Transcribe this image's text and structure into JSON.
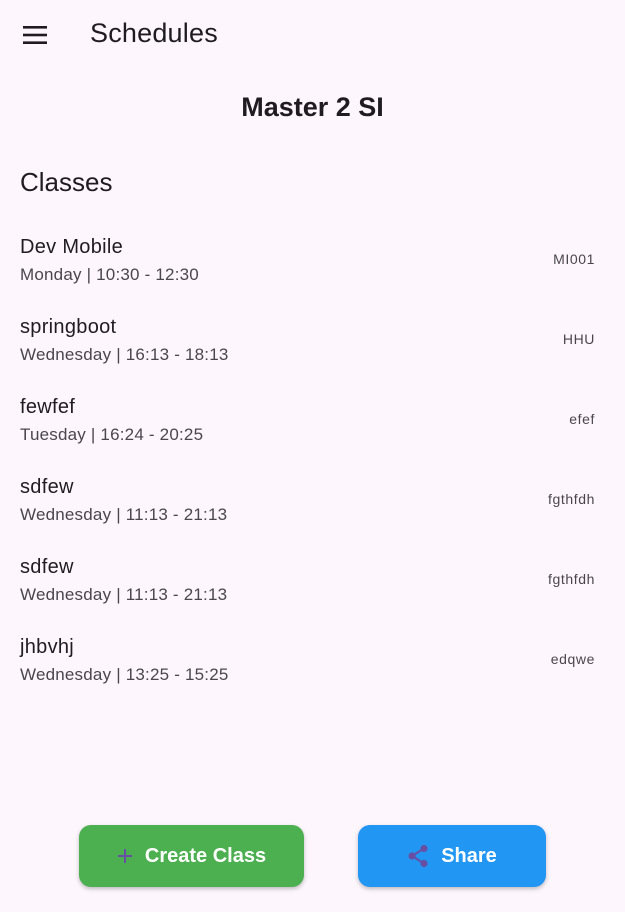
{
  "appbar": {
    "menu_icon": "menu-icon",
    "title": "Schedules"
  },
  "schedule": {
    "name": "Master 2 SI"
  },
  "classes_section": {
    "title": "Classes",
    "items": [
      {
        "name": "Dev Mobile",
        "time": "Monday | 10:30 - 12:30",
        "code": "MI001"
      },
      {
        "name": "springboot",
        "time": "Wednesday | 16:13 - 18:13",
        "code": "HHU"
      },
      {
        "name": "fewfef",
        "time": "Tuesday | 16:24 - 20:25",
        "code": "efef"
      },
      {
        "name": "sdfew",
        "time": "Wednesday | 11:13 - 21:13",
        "code": "fgthfdh"
      },
      {
        "name": "sdfew",
        "time": "Wednesday | 11:13 - 21:13",
        "code": "fgthfdh"
      },
      {
        "name": "jhbvhj",
        "time": "Wednesday | 13:25 - 15:25",
        "code": "edqwe"
      }
    ]
  },
  "actions": {
    "create": {
      "label": "Create Class",
      "icon": "plus-icon",
      "color": "#4caf50"
    },
    "share": {
      "label": "Share",
      "icon": "share-icon",
      "color": "#2196f3"
    }
  },
  "colors": {
    "background": "#fdf7fd",
    "icon_purple": "#6750a4"
  }
}
